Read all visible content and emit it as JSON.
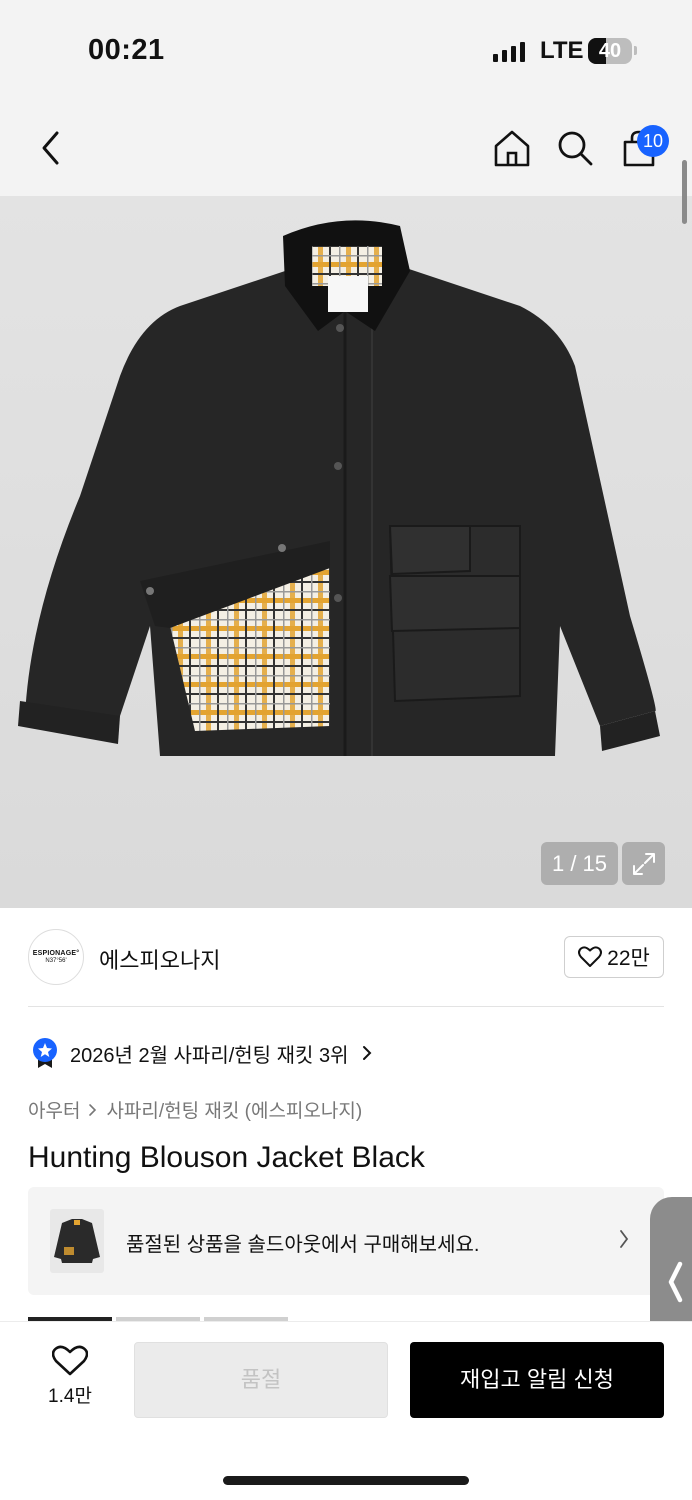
{
  "status_bar": {
    "time": "00:21",
    "network": "LTE",
    "battery": "40"
  },
  "nav": {
    "back_icon": "chevron-left-icon",
    "home_icon": "home-icon",
    "search_icon": "search-icon",
    "cart_icon": "shopping-bag-icon",
    "cart_count": "10"
  },
  "gallery": {
    "counter": "1 / 15",
    "expand_icon": "expand-icon"
  },
  "brand": {
    "logo_line1": "ESPIONAGE°",
    "logo_line2": "N37°56'",
    "name": "에스피오나지",
    "likes": "22만"
  },
  "ranking": {
    "text": "2026년 2월 사파리/헌팅 재킷 3위"
  },
  "breadcrumb": {
    "category": "아우터",
    "subcategory": "사파리/헌팅 재킷 (에스피오나지)"
  },
  "product": {
    "title": "Hunting Blouson Jacket Black"
  },
  "soldout_banner": {
    "text": "품절된 상품을 솔드아웃에서 구매해보세요."
  },
  "bottom_bar": {
    "fav_count": "1.4만",
    "soldout_label": "품절",
    "restock_label": "재입고 알림 신청"
  },
  "colors": {
    "accent_blue": "#1863ff",
    "primary_black": "#000000",
    "disabled_gray": "#ebebeb"
  }
}
